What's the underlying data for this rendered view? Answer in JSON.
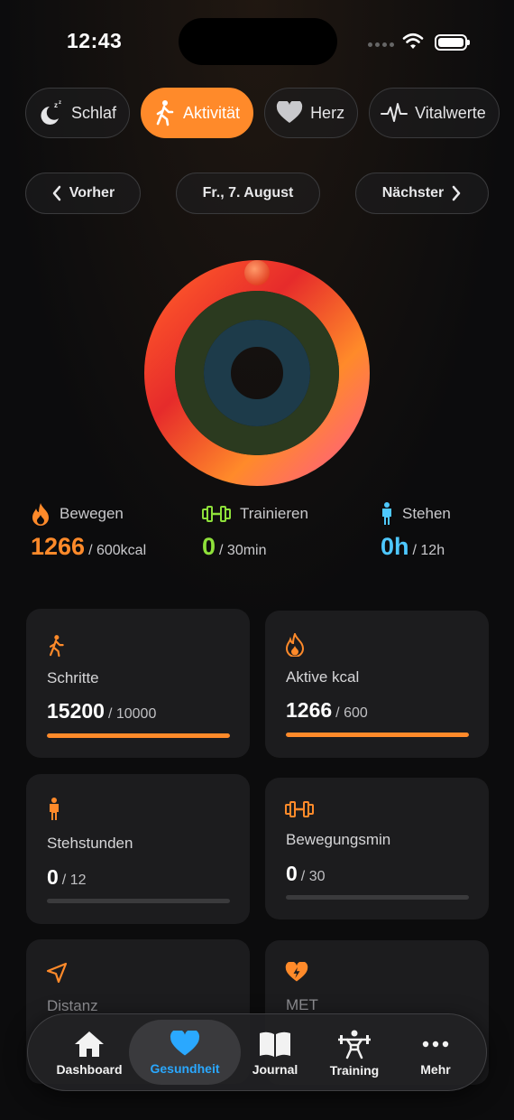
{
  "status": {
    "time": "12:43"
  },
  "tabs": [
    {
      "label": "Schlaf",
      "icon": "moon-icon",
      "active": false
    },
    {
      "label": "Aktivität",
      "icon": "walking-icon",
      "active": true
    },
    {
      "label": "Herz",
      "icon": "heart-icon",
      "active": false
    },
    {
      "label": "Vitalwerte",
      "icon": "pulse-icon",
      "active": false
    }
  ],
  "date_nav": {
    "prev": "Vorher",
    "date": "Fr., 7. August",
    "next": "Nächster"
  },
  "rings": {
    "move": {
      "label": "Bewegen",
      "value": "1266",
      "goal": "/ 600kcal",
      "color": "#ff8a2a",
      "fraction": 1.0
    },
    "exercise": {
      "label": "Trainieren",
      "value": "0",
      "goal": "/ 30min",
      "color": "#8ee03a",
      "fraction": 0
    },
    "stand": {
      "label": "Stehen",
      "value": "0h",
      "goal": "/ 12h",
      "color": "#4ec8ff",
      "fraction": 0
    }
  },
  "cards": [
    {
      "label": "Schritte",
      "value": "15200",
      "goal": "/ 10000",
      "icon": "walking-icon",
      "progress": 1.0
    },
    {
      "label": "Aktive kcal",
      "value": "1266",
      "goal": "/ 600",
      "icon": "flame-icon",
      "progress": 1.0
    },
    {
      "label": "Stehstunden",
      "value": "0",
      "goal": "/ 12",
      "icon": "standing-person-icon",
      "progress": 0
    },
    {
      "label": "Bewegungsmin",
      "value": "0",
      "goal": "/ 30",
      "icon": "dumbbell-icon",
      "progress": 0
    },
    {
      "label": "Distanz",
      "icon": "location-arrow-icon"
    },
    {
      "label": "MET",
      "icon": "heart-bolt-icon"
    }
  ],
  "tabbar": [
    {
      "label": "Dashboard",
      "icon": "house-icon",
      "active": false
    },
    {
      "label": "Gesundheit",
      "icon": "heart-icon",
      "active": true
    },
    {
      "label": "Journal",
      "icon": "book-icon",
      "active": false
    },
    {
      "label": "Training",
      "icon": "weightlifter-icon",
      "active": false
    },
    {
      "label": "Mehr",
      "icon": "ellipsis-icon",
      "active": false
    }
  ],
  "colors": {
    "accent": "#ff8a2a",
    "tabbar_active": "#2aa8ff",
    "card_bg": "#1c1c1e"
  }
}
